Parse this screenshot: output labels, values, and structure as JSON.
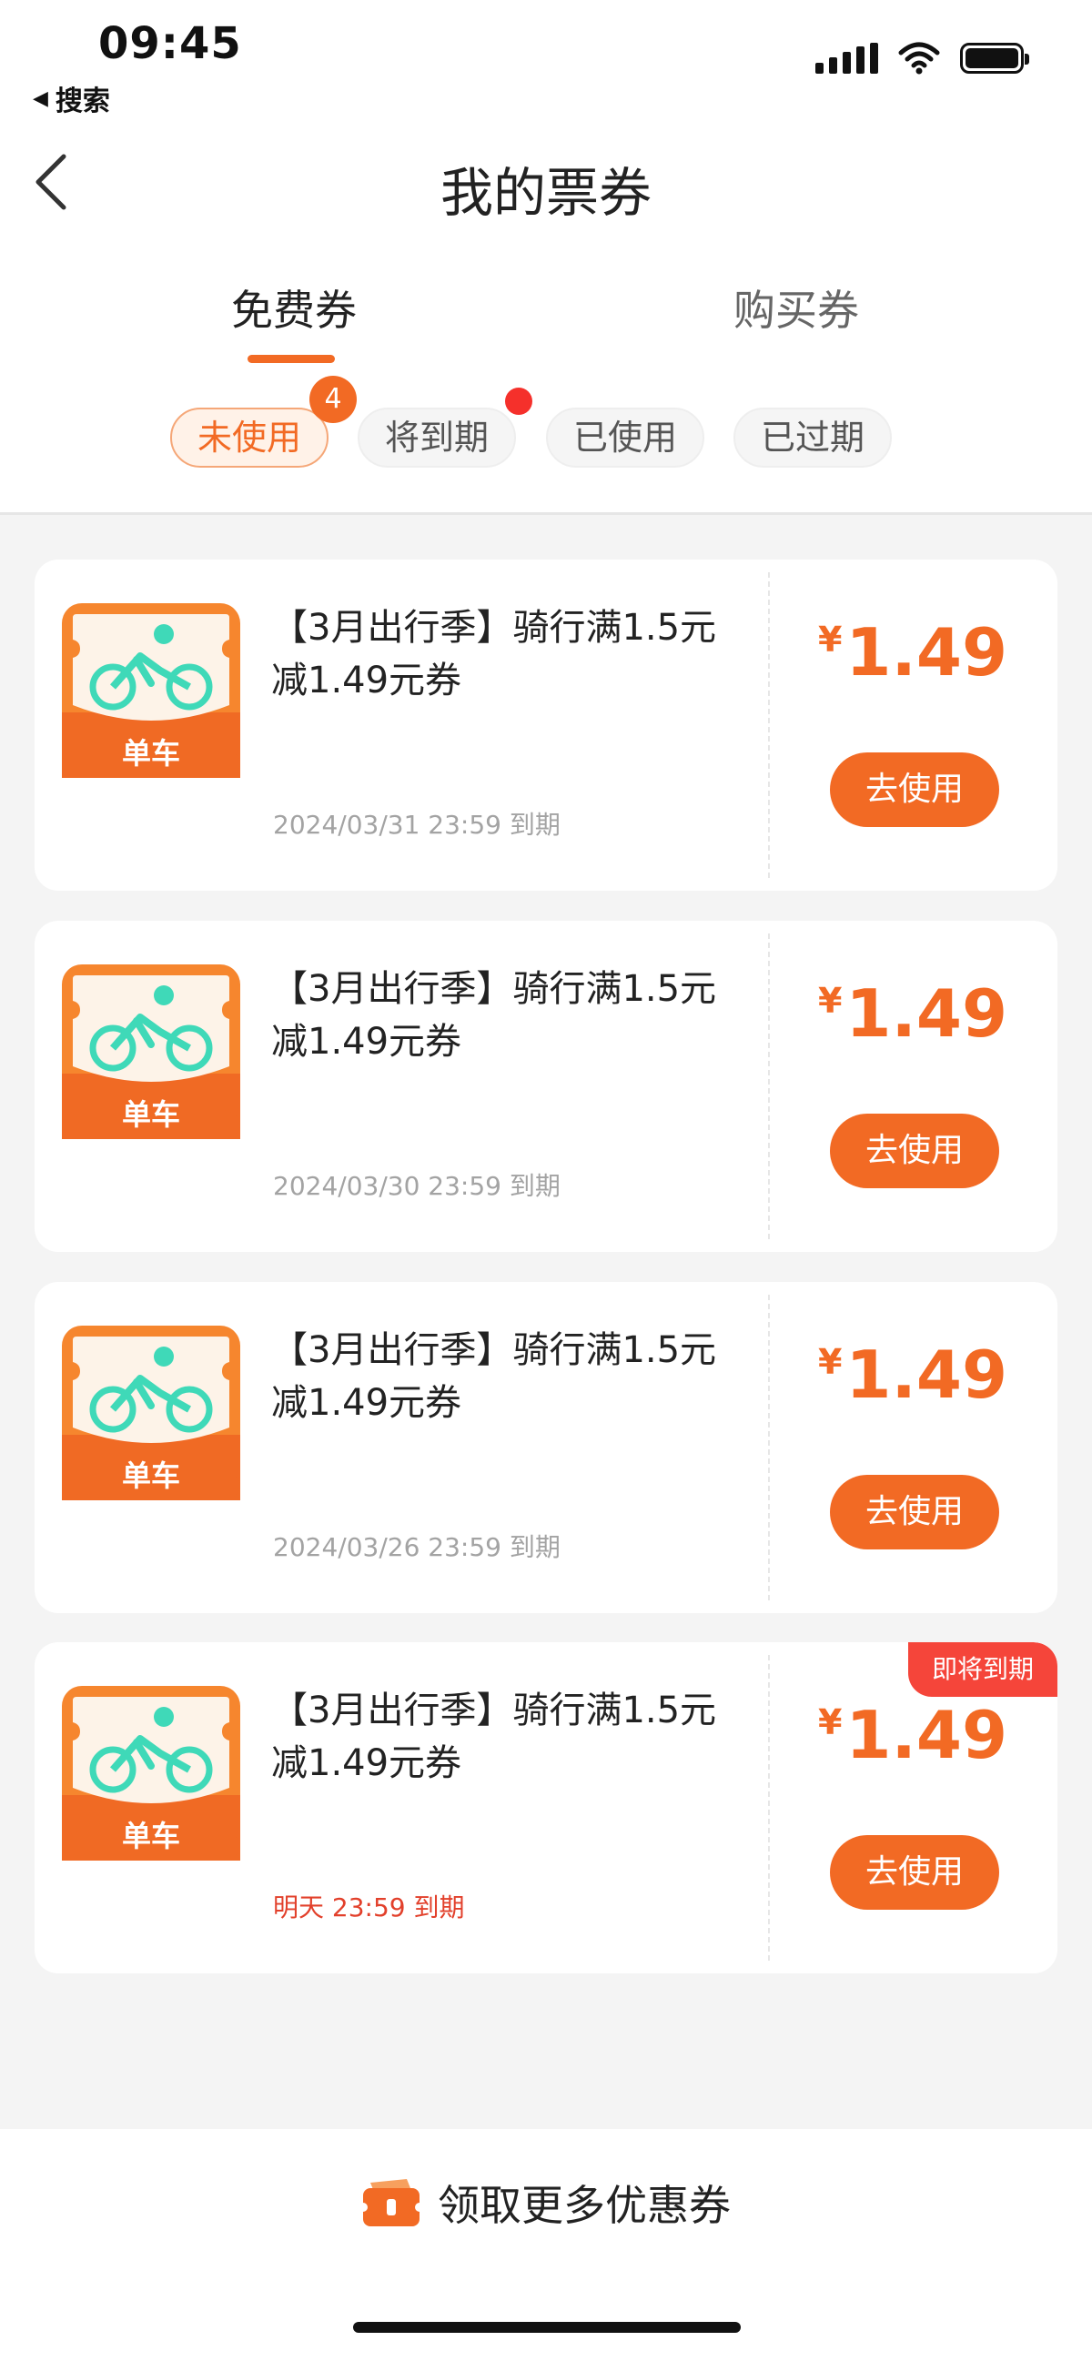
{
  "status_bar": {
    "time": "09:45",
    "back_label": "搜索",
    "back_icon": "triangle-left-icon"
  },
  "nav": {
    "title": "我的票券",
    "back_icon": "chevron-left-icon"
  },
  "tabs": [
    {
      "label": "免费券",
      "active": true
    },
    {
      "label": "购买券",
      "active": false
    }
  ],
  "filters": [
    {
      "label": "未使用",
      "active": true,
      "badge": "4"
    },
    {
      "label": "将到期",
      "active": false,
      "dot": true
    },
    {
      "label": "已使用",
      "active": false
    },
    {
      "label": "已过期",
      "active": false
    }
  ],
  "coupons": [
    {
      "icon_label": "单车",
      "title": "【3月出行季】骑行满1.5元减1.49元券",
      "expiry": "2024/03/31 23:59 到期",
      "currency": "¥",
      "amount": "1.49",
      "button_label": "去使用"
    },
    {
      "icon_label": "单车",
      "title": "【3月出行季】骑行满1.5元减1.49元券",
      "expiry": "2024/03/30 23:59 到期",
      "currency": "¥",
      "amount": "1.49",
      "button_label": "去使用"
    },
    {
      "icon_label": "单车",
      "title": "【3月出行季】骑行满1.5元减1.49元券",
      "expiry": "2024/03/26 23:59 到期",
      "currency": "¥",
      "amount": "1.49",
      "button_label": "去使用"
    },
    {
      "icon_label": "单车",
      "title": "【3月出行季】骑行满1.5元减1.49元券",
      "expiry": "明天 23:59 到期",
      "currency": "¥",
      "amount": "1.49",
      "button_label": "去使用",
      "tag": "即将到期"
    }
  ],
  "bottom": {
    "get_more_label": "领取更多优惠券",
    "icon": "coupon-ticket-icon"
  },
  "colors": {
    "accent": "#f26a24",
    "urgent": "#e2402b",
    "icon_teal": "#3fd9b8"
  }
}
